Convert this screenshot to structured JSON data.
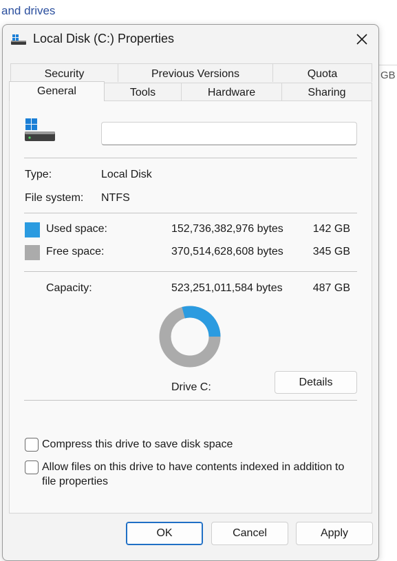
{
  "background": {
    "top_text": "and drives",
    "right_text": "GB"
  },
  "window": {
    "title": "Local Disk (C:) Properties",
    "icons": {
      "title": "drive-icon",
      "close": "close-icon"
    }
  },
  "tabs": {
    "row_back": [
      "Security",
      "Previous Versions",
      "Quota"
    ],
    "row_front": [
      "General",
      "Tools",
      "Hardware",
      "Sharing"
    ],
    "active": "General"
  },
  "general": {
    "name_value": "",
    "type_label": "Type:",
    "type_value": "Local Disk",
    "fs_label": "File system:",
    "fs_value": "NTFS",
    "used": {
      "label": "Used space:",
      "bytes": "152,736,382,976 bytes",
      "size": "142 GB",
      "color": "#2b9be0"
    },
    "free": {
      "label": "Free space:",
      "bytes": "370,514,628,608 bytes",
      "size": "345 GB",
      "color": "#ababab"
    },
    "capacity": {
      "label": "Capacity:",
      "bytes": "523,251,011,584 bytes",
      "size": "487 GB"
    },
    "used_fraction": 0.2919,
    "drive_label": "Drive C:",
    "details_button": "Details",
    "checkbox_compress": {
      "label": "Compress this drive to save disk space",
      "checked": false
    },
    "checkbox_index": {
      "label": "Allow files on this drive to have contents indexed in addition to file properties",
      "checked": false
    }
  },
  "buttons": {
    "ok": "OK",
    "cancel": "Cancel",
    "apply": "Apply"
  }
}
